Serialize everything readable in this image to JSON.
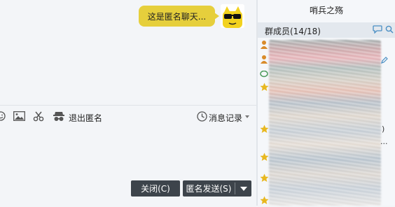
{
  "chat": {
    "bubble_text": "这是匿名聊天...",
    "avatar_icon": "sunglasses-avatar-icon"
  },
  "toolbar": {
    "emoji_icon": "emoji-icon",
    "image_icon": "image-icon",
    "scissors_icon": "scissors-icon",
    "anonymous_icon": "anonymous-icon",
    "exit_anonymous_label": "退出匿名",
    "history_icon": "clock-icon",
    "history_label": "消息记录"
  },
  "footer": {
    "close_label": "关闭(C)",
    "send_label": "匿名发送(S)"
  },
  "right_panel": {
    "group_name": "哨兵之殇",
    "members_title": "群成员(14/18)",
    "side_chars": [
      ")",
      "..."
    ]
  },
  "colors": {
    "bubble": "#e6cf3c",
    "button_dark": "#3d444b",
    "panel_header": "#e3e8ee",
    "accent_blue": "#4a8fc4"
  }
}
